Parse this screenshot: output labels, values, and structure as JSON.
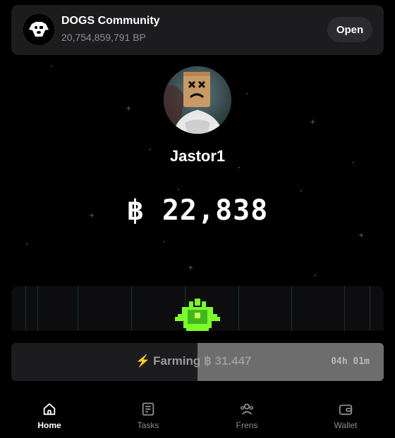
{
  "community": {
    "logo_icon": "dog-logo-icon",
    "title": "DOGS Community",
    "subtitle": "20,754,859,791 BP",
    "open_label": "Open"
  },
  "profile": {
    "avatar_icon": "masked-figure-avatar",
    "username": "Jastor1",
    "balance": "฿ 22,838"
  },
  "farming": {
    "icon": "lightning-icon",
    "label": "Farming ฿ 31.447",
    "timer": "04h 01m",
    "progress": 0.5
  },
  "nav": {
    "items": [
      {
        "label": "Home",
        "icon": "home-icon",
        "active": true
      },
      {
        "label": "Tasks",
        "icon": "tasks-icon",
        "active": false
      },
      {
        "label": "Frens",
        "icon": "frens-icon",
        "active": false
      },
      {
        "label": "Wallet",
        "icon": "wallet-icon",
        "active": false
      }
    ]
  },
  "colors": {
    "background": "#000000",
    "card": "#1c1c1e",
    "accent_green": "#7cfc2a",
    "bolt": "#f4c542"
  }
}
